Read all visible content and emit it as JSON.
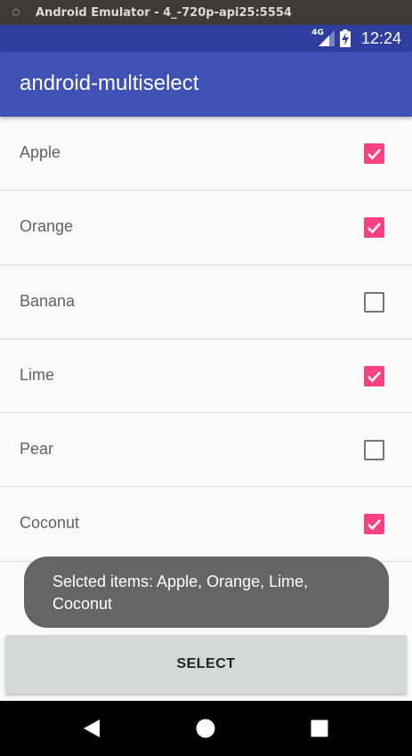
{
  "emulator": {
    "title": "Android Emulator - 4_-720p-api25:5554"
  },
  "status_bar": {
    "network": "4G",
    "time": "12:24",
    "icons": [
      "signal-icon",
      "battery-charging-icon"
    ]
  },
  "app_bar": {
    "title": "android-multiselect"
  },
  "items": [
    {
      "label": "Apple",
      "checked": true
    },
    {
      "label": "Orange",
      "checked": true
    },
    {
      "label": "Banana",
      "checked": false
    },
    {
      "label": "Lime",
      "checked": true
    },
    {
      "label": "Pear",
      "checked": false
    },
    {
      "label": "Coconut",
      "checked": true
    }
  ],
  "toast": {
    "text": "Selcted items: Apple, Orange, Lime, Coconut"
  },
  "select_button": {
    "label": "SELECT"
  },
  "nav_bar": {
    "buttons": [
      "back-icon",
      "home-icon",
      "recents-icon"
    ]
  },
  "colors": {
    "primary": "#3f51b5",
    "primary_dark": "#303f9f",
    "accent": "#ff4081"
  }
}
